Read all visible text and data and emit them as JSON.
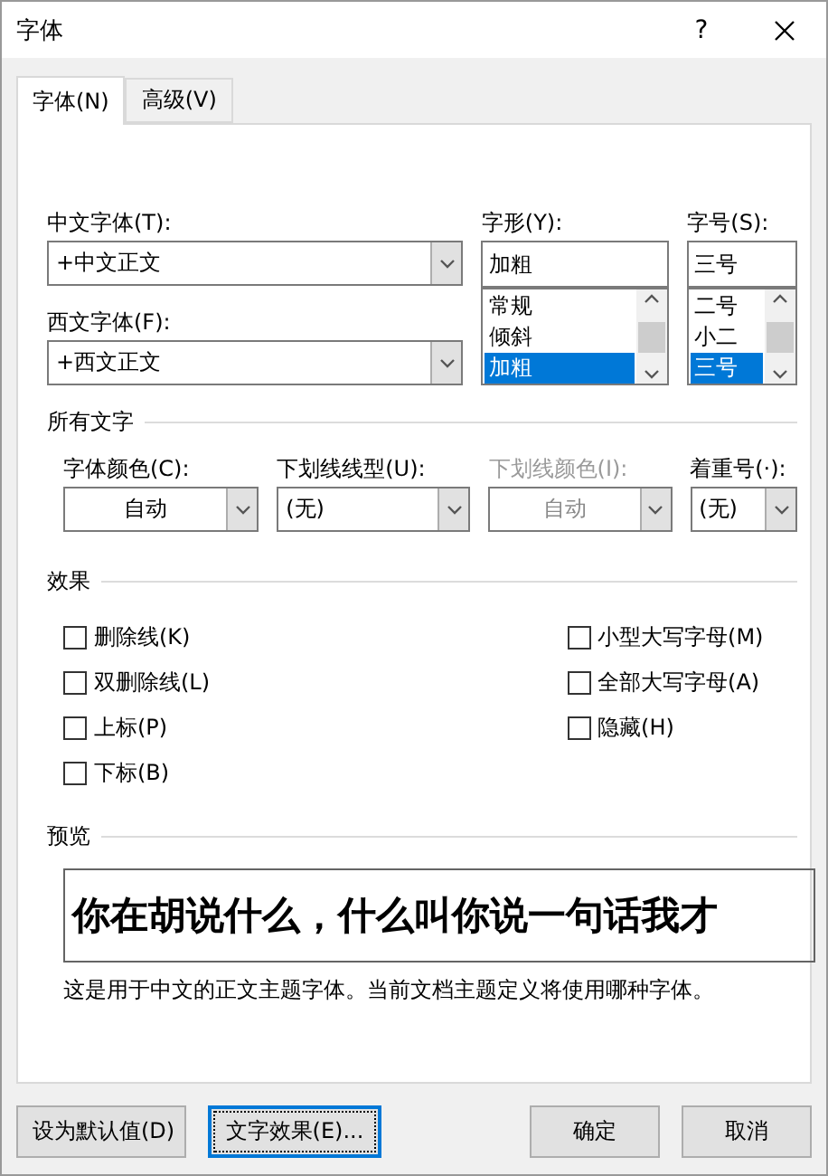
{
  "window": {
    "title": "字体",
    "help": "?"
  },
  "tabs": [
    {
      "label": "字体(N)",
      "selected": true
    },
    {
      "label": "高级(V)",
      "selected": false
    }
  ],
  "fonts": [
    {
      "label": "中文字体(T):",
      "value": "+中文正文"
    },
    {
      "label": "西文字体(F):",
      "value": "+西文正文"
    }
  ],
  "style": {
    "label": "字形(Y):",
    "value": "加粗",
    "options": [
      {
        "label": "常规",
        "selected": false
      },
      {
        "label": "倾斜",
        "selected": false
      },
      {
        "label": "加粗",
        "selected": true
      }
    ]
  },
  "size": {
    "label": "字号(S):",
    "value": "三号",
    "options": [
      {
        "label": "二号",
        "selected": false
      },
      {
        "label": "小二",
        "selected": false
      },
      {
        "label": "三号",
        "selected": true
      }
    ]
  },
  "all_text": {
    "heading": "所有文字",
    "selects": [
      {
        "kind": "color",
        "label": "字体颜色(C):",
        "value": "自动",
        "disabled": false
      },
      {
        "kind": "list",
        "label": "下划线线型(U):",
        "value": "(无)",
        "disabled": false
      },
      {
        "kind": "color",
        "label": "下划线颜色(I):",
        "value": "自动",
        "disabled": true
      },
      {
        "kind": "list",
        "label": "着重号(·):",
        "value": "(无)",
        "disabled": false
      }
    ]
  },
  "effects": {
    "heading": "效果",
    "left": [
      {
        "label": "删除线(K)",
        "checked": false
      },
      {
        "label": "双删除线(L)",
        "checked": false
      },
      {
        "label": "上标(P)",
        "checked": false
      },
      {
        "label": "下标(B)",
        "checked": false
      }
    ],
    "right": [
      {
        "label": "小型大写字母(M)",
        "checked": false
      },
      {
        "label": "全部大写字母(A)",
        "checked": false
      },
      {
        "label": "隐藏(H)",
        "checked": false
      }
    ]
  },
  "preview": {
    "heading": "预览",
    "sample": "你在胡说什么，什么叫你说一句话我才",
    "note": "这是用于中文的正文主题字体。当前文档主题定义将使用哪种字体。"
  },
  "buttons": [
    {
      "label": "设为默认值(D)",
      "focused": false
    },
    {
      "label": "文字效果(E)...",
      "focused": true
    },
    {
      "label": "确定",
      "focused": false
    },
    {
      "label": "取消",
      "focused": false
    }
  ]
}
